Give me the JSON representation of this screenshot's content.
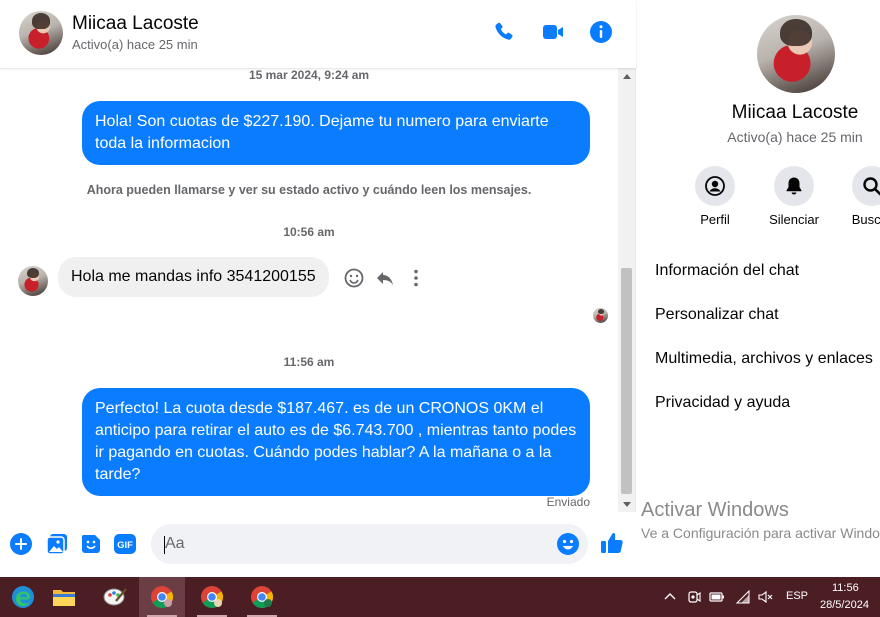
{
  "colors": {
    "accent": "#0a7cff",
    "messenger_blue": "#0084ff",
    "taskbar": "#4b1e24"
  },
  "header": {
    "name": "Miicaa Lacoste",
    "status": "Activo(a) hace 25 min",
    "icons": [
      "phone-icon",
      "video-icon",
      "info-icon"
    ]
  },
  "messages": {
    "ts1": "15 mar 2024, 9:24 am",
    "msg1": "Hola! Son cuotas de $227.190. Dejame tu numero para enviarte toda la informacion",
    "notice": "Ahora pueden llamarse y ver su estado activo y cuándo leen los mensajes.",
    "ts2": "10:56 am",
    "msg2": "Hola me mandas info 3541200155",
    "ts3": "11:56 am",
    "msg3": "Perfecto! La cuota desde $187.467. es de un CRONOS 0KM el anticipo para retirar el auto es de $6.743.700 , mientras tanto podes ir pagando en cuotas. Cuándo podes hablar? A la mañana o a la tarde?",
    "sent": "Enviado"
  },
  "composer": {
    "placeholder": "Aa",
    "icons": [
      "add-icon",
      "gallery-icon",
      "sticker-icon",
      "gif-icon",
      "emoji-icon",
      "like-icon"
    ],
    "gif_label": "GIF"
  },
  "info_panel": {
    "name": "Miicaa Lacoste",
    "status": "Activo(a) hace 25 min",
    "actions": [
      {
        "label": "Perfil",
        "icon": "profile-icon"
      },
      {
        "label": "Silenciar",
        "icon": "bell-icon"
      },
      {
        "label": "Buscar",
        "icon": "search-icon"
      }
    ],
    "menu": [
      "Información del chat",
      "Personalizar chat",
      "Multimedia, archivos y enlaces",
      "Privacidad y ayuda"
    ]
  },
  "watermark": {
    "title": "Activar Windows",
    "subtitle": "Ve a Configuración para activar Windows."
  },
  "taskbar": {
    "apps": [
      "edge-icon",
      "file-explorer-icon",
      "paint-icon",
      "chrome-icon",
      "chrome-icon",
      "chrome-icon"
    ],
    "language": "ESP",
    "time": "11:56",
    "date": "28/5/2024"
  }
}
